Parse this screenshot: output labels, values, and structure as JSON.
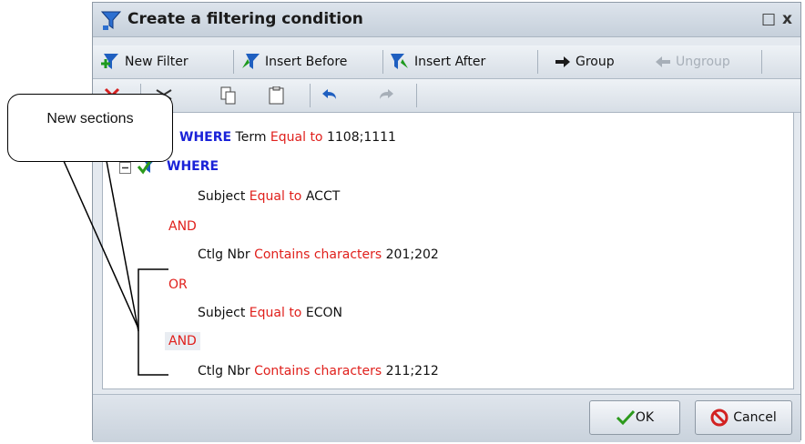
{
  "dialog": {
    "title": "Create a filtering condition",
    "close_glyph": "x",
    "maximize_glyph": "□"
  },
  "toolbar1": {
    "new_filter": "New Filter",
    "insert_before": "Insert Before",
    "insert_after": "Insert After",
    "group": "Group",
    "ungroup": "Ungroup"
  },
  "toolbar2": {
    "icons": [
      "delete-icon",
      "cut-icon",
      "copy-icon",
      "paste-icon",
      "undo-icon",
      "redo-icon"
    ]
  },
  "conditions": {
    "row1": {
      "keyword": "WHERE",
      "field": "Term",
      "operator": "Equal to",
      "value": "1108;1111"
    },
    "row2": {
      "keyword": "WHERE"
    },
    "row3": {
      "field": "Subject",
      "operator": "Equal to",
      "value": "ACCT"
    },
    "row4": {
      "connector": "AND"
    },
    "row5": {
      "field": "Ctlg Nbr",
      "operator": "Contains characters",
      "value": "201;202"
    },
    "row6": {
      "connector": "OR"
    },
    "row7": {
      "field": "Subject",
      "operator": "Equal to",
      "value": "ECON"
    },
    "row8": {
      "connector": "AND"
    },
    "row9": {
      "field": "Ctlg Nbr",
      "operator": "Contains characters",
      "value": "211;212"
    }
  },
  "footer": {
    "ok": "OK",
    "cancel": "Cancel"
  },
  "callout": {
    "text": "New sections"
  },
  "colors": {
    "keyword": "#1a22d8",
    "operator": "#e0201c",
    "ok_check": "#2c9a1c",
    "cancel_icon": "#d22222"
  }
}
